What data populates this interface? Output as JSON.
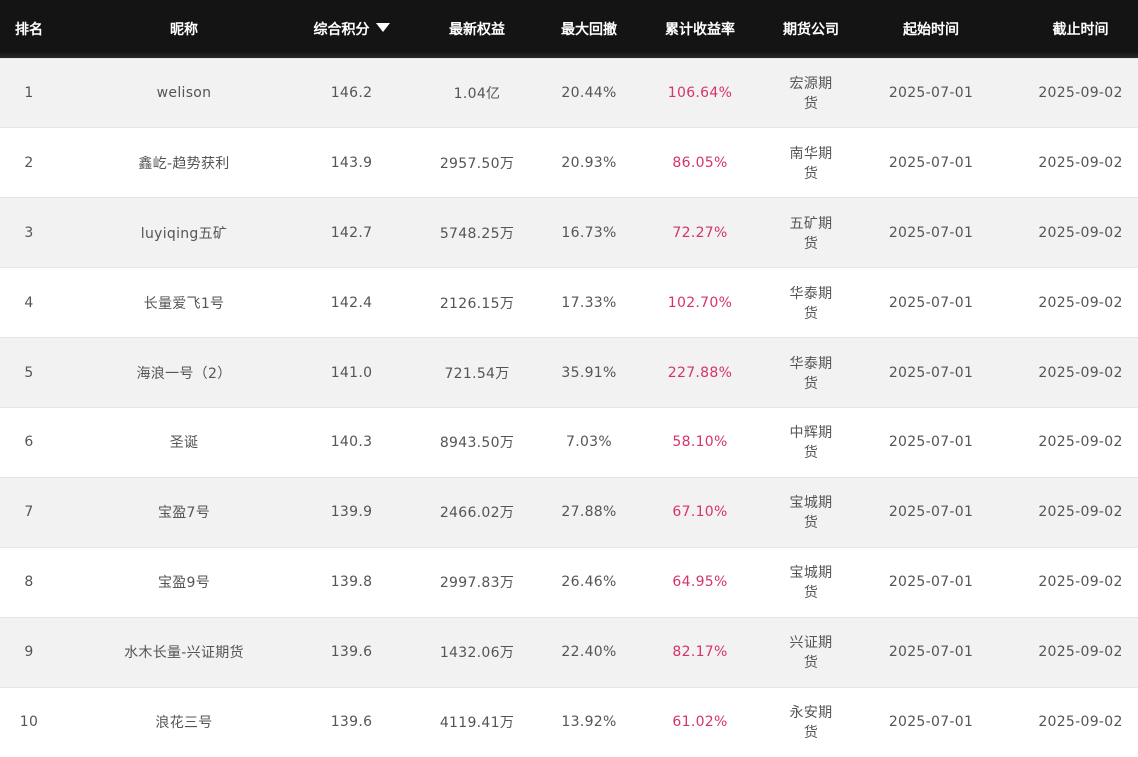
{
  "columns": [
    {
      "label": "排名"
    },
    {
      "label": "昵称"
    },
    {
      "label": "综合积分",
      "sorted": "desc"
    },
    {
      "label": "最新权益"
    },
    {
      "label": "最大回撤"
    },
    {
      "label": "累计收益率"
    },
    {
      "label": "期货公司"
    },
    {
      "label": "起始时间"
    },
    {
      "label": "截止时间"
    }
  ],
  "colors": {
    "header_bg": "#141414",
    "header_text": "#ffffff",
    "row_alt_bg": "#f2f2f2",
    "cell_text": "#555555",
    "return_text": "#d6336c"
  },
  "sort_icon": "caret-down-icon",
  "rows": [
    {
      "rank": "1",
      "nickname": "welison",
      "score": "146.2",
      "equity": "1.04亿",
      "drawdown": "20.44%",
      "return": "106.64%",
      "broker": "宏源期货",
      "start": "2025-07-01",
      "end": "2025-09-02"
    },
    {
      "rank": "2",
      "nickname": "鑫屹-趋势获利",
      "score": "143.9",
      "equity": "2957.50万",
      "drawdown": "20.93%",
      "return": "86.05%",
      "broker": "南华期货",
      "start": "2025-07-01",
      "end": "2025-09-02"
    },
    {
      "rank": "3",
      "nickname": "luyiqing五矿",
      "score": "142.7",
      "equity": "5748.25万",
      "drawdown": "16.73%",
      "return": "72.27%",
      "broker": "五矿期货",
      "start": "2025-07-01",
      "end": "2025-09-02"
    },
    {
      "rank": "4",
      "nickname": "长量爱飞1号",
      "score": "142.4",
      "equity": "2126.15万",
      "drawdown": "17.33%",
      "return": "102.70%",
      "broker": "华泰期货",
      "start": "2025-07-01",
      "end": "2025-09-02"
    },
    {
      "rank": "5",
      "nickname": "海浪一号（2）",
      "score": "141.0",
      "equity": "721.54万",
      "drawdown": "35.91%",
      "return": "227.88%",
      "broker": "华泰期货",
      "start": "2025-07-01",
      "end": "2025-09-02"
    },
    {
      "rank": "6",
      "nickname": "圣诞",
      "score": "140.3",
      "equity": "8943.50万",
      "drawdown": "7.03%",
      "return": "58.10%",
      "broker": "中辉期货",
      "start": "2025-07-01",
      "end": "2025-09-02"
    },
    {
      "rank": "7",
      "nickname": "宝盈7号",
      "score": "139.9",
      "equity": "2466.02万",
      "drawdown": "27.88%",
      "return": "67.10%",
      "broker": "宝城期货",
      "start": "2025-07-01",
      "end": "2025-09-02"
    },
    {
      "rank": "8",
      "nickname": "宝盈9号",
      "score": "139.8",
      "equity": "2997.83万",
      "drawdown": "26.46%",
      "return": "64.95%",
      "broker": "宝城期货",
      "start": "2025-07-01",
      "end": "2025-09-02"
    },
    {
      "rank": "9",
      "nickname": "水木长量-兴证期货",
      "score": "139.6",
      "equity": "1432.06万",
      "drawdown": "22.40%",
      "return": "82.17%",
      "broker": "兴证期货",
      "start": "2025-07-01",
      "end": "2025-09-02"
    },
    {
      "rank": "10",
      "nickname": "浪花三号",
      "score": "139.6",
      "equity": "4119.41万",
      "drawdown": "13.92%",
      "return": "61.02%",
      "broker": "永安期货",
      "start": "2025-07-01",
      "end": "2025-09-02"
    }
  ]
}
